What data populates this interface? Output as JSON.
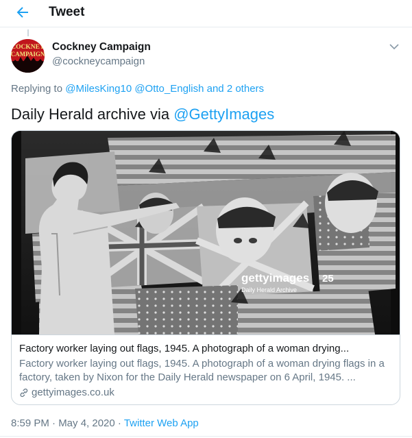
{
  "header": {
    "title": "Tweet",
    "back_icon": "arrow-left-icon",
    "accent": "#1da1f2"
  },
  "tweet": {
    "author_name": "Cockney Campaign",
    "author_handle": "@cockneycampaign",
    "avatar_text_line1": "COCKNEY",
    "avatar_text_line2": "CAMPAIGN",
    "replying_prefix": "Replying to",
    "replying_users": [
      "@MilesKing10",
      "@Otto_English"
    ],
    "replying_and": "and",
    "replying_others": "2 others",
    "text_prefix": "Daily Herald archive via ",
    "text_mention": "@GettyImages",
    "timestamp": "8:59 PM · May 4, 2020 · ",
    "source": "Twitter Web App"
  },
  "card": {
    "title": "Factory worker laying out flags, 1945. A photograph of a woman drying...",
    "description": "Factory worker laying out flags, 1945. A photograph of a woman drying flags in a factory, taken by Nixon for the Daily Herald newspaper on 6 April, 1945. ...",
    "domain": "gettyimages.co.uk",
    "link_icon": "link-icon",
    "watermark_brand": "gettyimages",
    "watermark_credit": "Daily Herald Archive",
    "watermark_badge": "25"
  }
}
